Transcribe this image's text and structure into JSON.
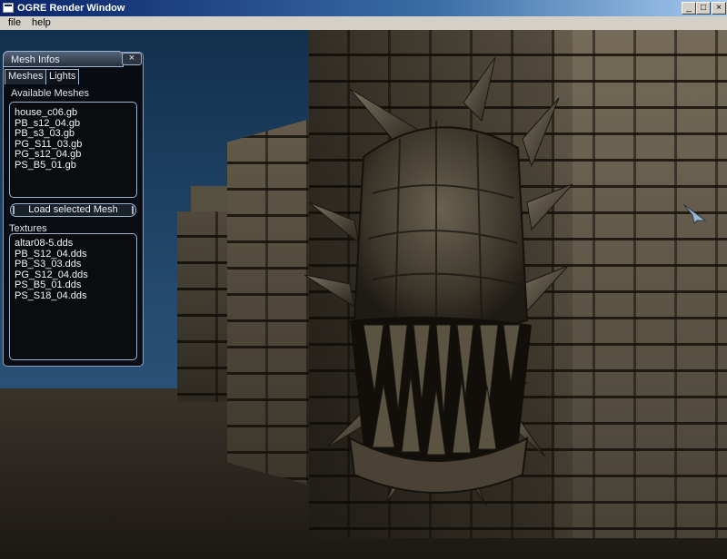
{
  "window": {
    "title": "OGRE Render Window",
    "controls": {
      "minimize": "_",
      "maximize": "□",
      "close": "×"
    }
  },
  "menubar": {
    "items": [
      {
        "label": "file"
      },
      {
        "label": "help"
      }
    ]
  },
  "panel": {
    "title": "Mesh Infos",
    "close_glyph": "×",
    "tabs": [
      {
        "label": "Meshes",
        "active": true
      },
      {
        "label": "Lights",
        "active": false
      }
    ],
    "meshes": {
      "label": "Available Meshes",
      "items": [
        "house_c06.gb",
        "PB_s12_04.gb",
        "PB_s3_03.gb",
        "PG_S11_03.gb",
        "PG_s12_04.gb",
        "PS_B5_01.gb"
      ]
    },
    "load_button": "Load selected Mesh",
    "textures": {
      "label": "Textures",
      "items": [
        "altar08-5.dds",
        "PB_S12_04.dds",
        "PB_S3_03.dds",
        "PG_S12_04.dds",
        "PS_B5_01.dds",
        "PS_S18_04.dds"
      ]
    }
  },
  "colors": {
    "title_bar": "#0a246a",
    "panel_border": "#9db3cf",
    "panel_bg": "#08080c",
    "sky": "#244a6e"
  },
  "scene": {
    "icons": [
      "mouse-cursor-icon"
    ]
  }
}
